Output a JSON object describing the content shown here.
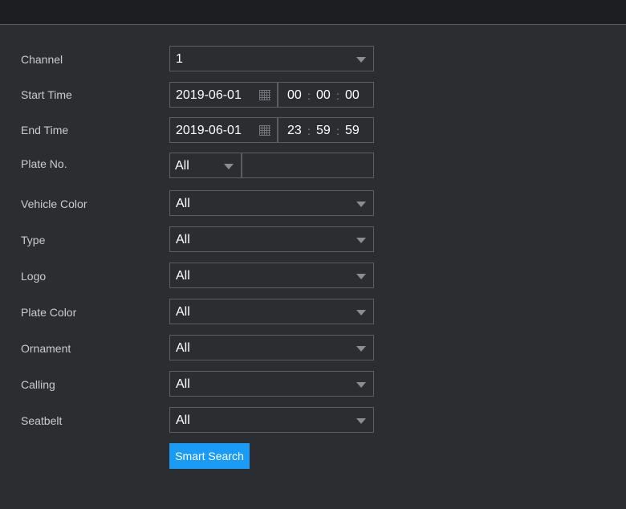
{
  "form": {
    "channel": {
      "label": "Channel",
      "value": "1"
    },
    "start_time": {
      "label": "Start Time",
      "date": "2019-06-01",
      "hh": "00",
      "mm": "00",
      "ss": "00"
    },
    "end_time": {
      "label": "End Time",
      "date": "2019-06-01",
      "hh": "23",
      "mm": "59",
      "ss": "59"
    },
    "plate_no": {
      "label": "Plate No.",
      "value": "All",
      "text": ""
    },
    "vehicle_color": {
      "label": "Vehicle Color",
      "value": "All"
    },
    "type": {
      "label": "Type",
      "value": "All"
    },
    "logo": {
      "label": "Logo",
      "value": "All"
    },
    "plate_color": {
      "label": "Plate Color",
      "value": "All"
    },
    "ornament": {
      "label": "Ornament",
      "value": "All"
    },
    "calling": {
      "label": "Calling",
      "value": "All"
    },
    "seatbelt": {
      "label": "Seatbelt",
      "value": "All"
    },
    "time_separator": ":",
    "smart_search_label": "Smart Search"
  }
}
